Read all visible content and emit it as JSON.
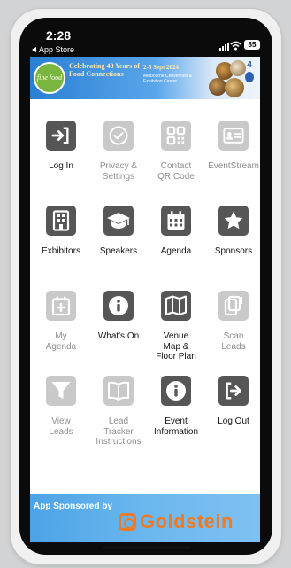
{
  "status_bar": {
    "time": "2:28",
    "back_label": "App Store",
    "battery": "85"
  },
  "banner": {
    "logo_text": "fine food",
    "title": "Celebrating 40 Years of Food Connections",
    "dates": "2-5 Sept 2024",
    "venue": "Melbourne Convention & Exhibition Centre"
  },
  "tiles": [
    {
      "label": "Log In",
      "icon": "login-icon",
      "enabled": true
    },
    {
      "label": "Privacy &\nSettings",
      "icon": "check-circle-icon",
      "enabled": false
    },
    {
      "label": "Contact\nQR Code",
      "icon": "qr-code-icon",
      "enabled": false
    },
    {
      "label": "EventStream",
      "icon": "id-card-icon",
      "enabled": false
    },
    {
      "label": "Exhibitors",
      "icon": "building-icon",
      "enabled": true
    },
    {
      "label": "Speakers",
      "icon": "graduation-cap-icon",
      "enabled": true
    },
    {
      "label": "Agenda",
      "icon": "calendar-icon",
      "enabled": true
    },
    {
      "label": "Sponsors",
      "icon": "star-icon",
      "enabled": true
    },
    {
      "label": "My\nAgenda",
      "icon": "calendar-plus-icon",
      "enabled": false
    },
    {
      "label": "What's On",
      "icon": "info-icon",
      "enabled": true
    },
    {
      "label": "Venue\nMap &\nFloor Plan",
      "icon": "map-icon",
      "enabled": true
    },
    {
      "label": "Scan\nLeads",
      "icon": "scan-device-icon",
      "enabled": false
    },
    {
      "label": "View\nLeads",
      "icon": "filter-icon",
      "enabled": false
    },
    {
      "label": "Lead\nTracker\nInstructions",
      "icon": "book-icon",
      "enabled": false
    },
    {
      "label": "Event\nInformation",
      "icon": "info-icon",
      "enabled": true
    },
    {
      "label": "Log Out",
      "icon": "logout-icon",
      "enabled": true
    }
  ],
  "footer": {
    "sponsor_label": "App Sponsored by",
    "sponsor_name": "Goldstein"
  }
}
